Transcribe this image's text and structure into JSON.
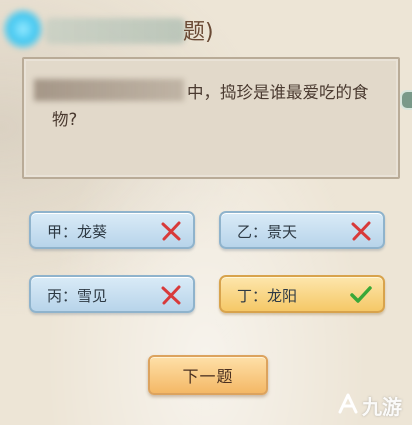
{
  "header": {
    "title_tail": "题)"
  },
  "question": {
    "text": "中，捣珍是谁最爱吃的食物?"
  },
  "options": [
    {
      "label": "甲：龙葵",
      "correct": false,
      "mark_icon": "x-mark-icon"
    },
    {
      "label": "乙：景天",
      "correct": false,
      "mark_icon": "x-mark-icon"
    },
    {
      "label": "丙：雪见",
      "correct": false,
      "mark_icon": "x-mark-icon"
    },
    {
      "label": "丁：龙阳",
      "correct": true,
      "mark_icon": "check-mark-icon"
    }
  ],
  "next_button": {
    "label": "下一题"
  },
  "watermark": {
    "text": "九游"
  },
  "colors": {
    "wrong_option_bg": "#c6dff0",
    "correct_option_bg": "#f8d07a",
    "x_mark": "#d83a3a",
    "check_mark": "#3aa838"
  }
}
